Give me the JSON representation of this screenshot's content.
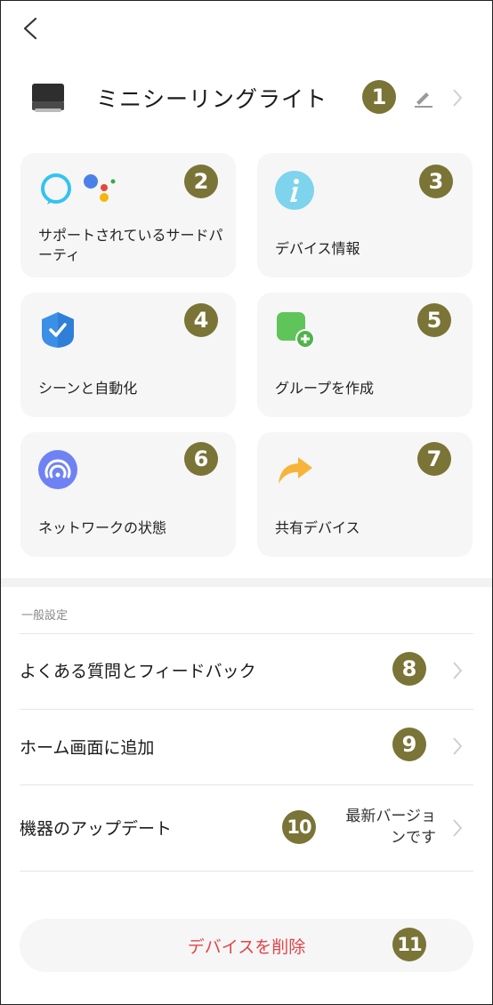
{
  "device": {
    "name": "ミニシーリングライト"
  },
  "cards": [
    {
      "label": "サポートされているサードパーティ",
      "icon": "alexa-google-assistant-icon",
      "badge": "2"
    },
    {
      "label": "デバイス情報",
      "icon": "info-icon",
      "badge": "3"
    },
    {
      "label": "シーンと自動化",
      "icon": "scene-shield-check-icon",
      "badge": "4"
    },
    {
      "label": "グループを作成",
      "icon": "group-add-icon",
      "badge": "5"
    },
    {
      "label": "ネットワークの状態",
      "icon": "network-signal-icon",
      "badge": "6"
    },
    {
      "label": "共有デバイス",
      "icon": "share-arrow-icon",
      "badge": "7"
    }
  ],
  "general": {
    "title": "一般設定",
    "rows": [
      {
        "label": "よくある質問とフィードバック",
        "badge": "8"
      },
      {
        "label": "ホーム画面に追加",
        "badge": "9"
      },
      {
        "label": "機器のアップデート",
        "badge": "10",
        "value": "最新バージョンです"
      }
    ]
  },
  "delete_label": "デバイスを削除",
  "header_badge": "1",
  "delete_badge": "11",
  "colors": {
    "badge": "#7a7436",
    "delete": "#e0454a",
    "card_bg": "#f6f6f6"
  }
}
